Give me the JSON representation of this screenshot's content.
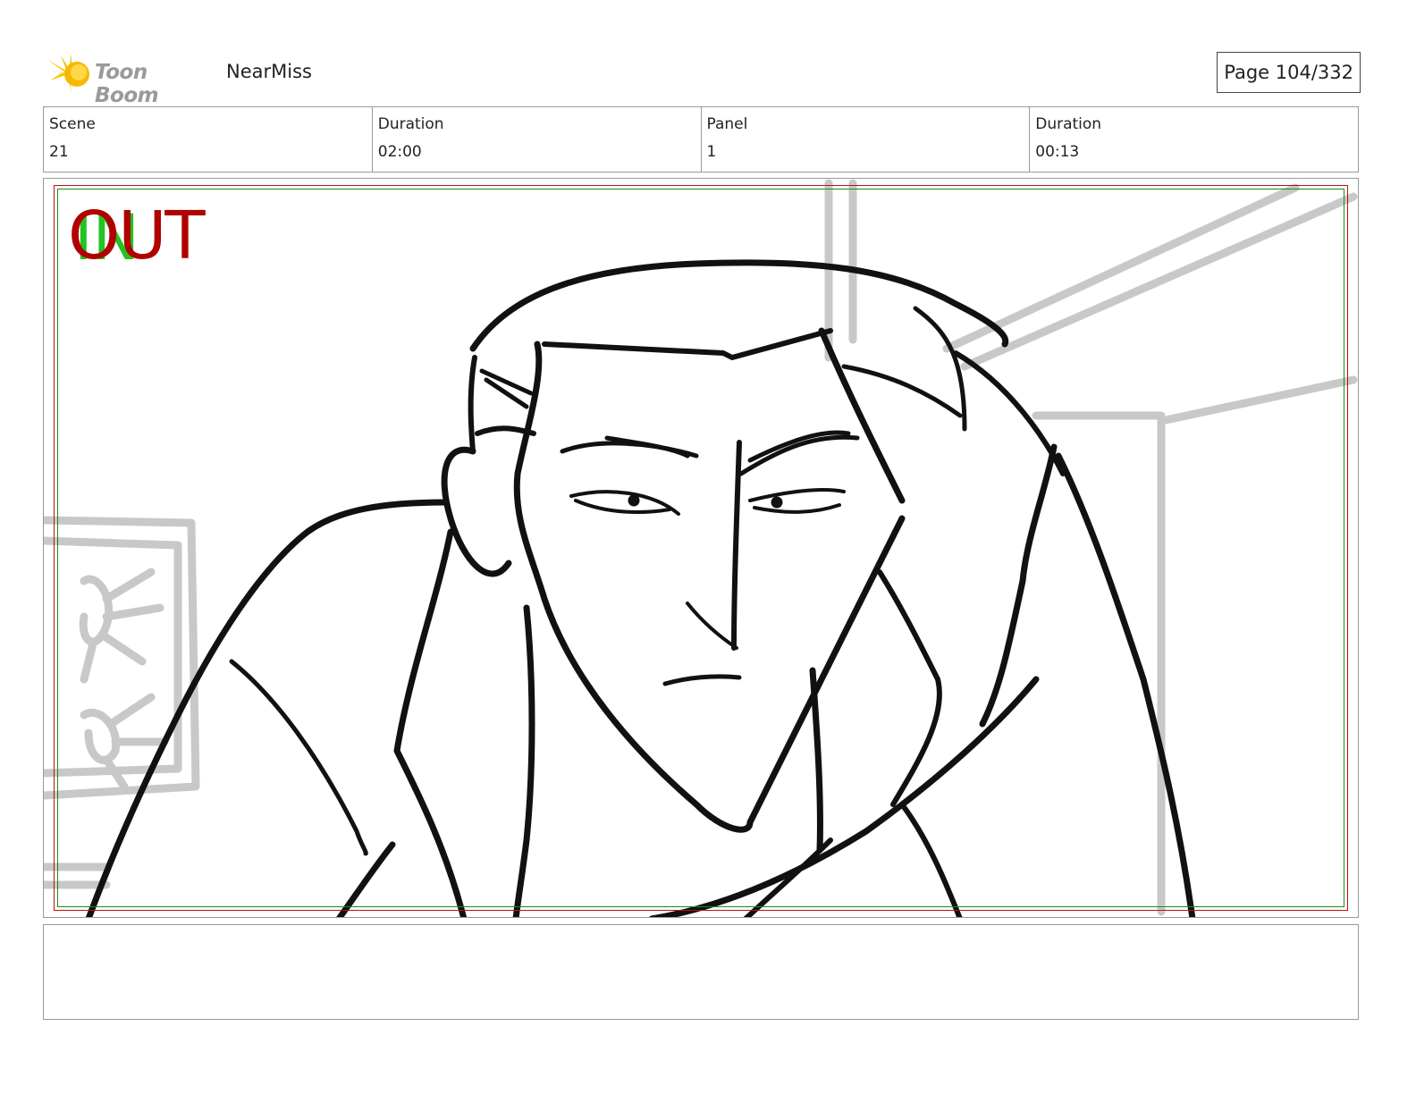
{
  "header": {
    "logo_text": "Toon Boom",
    "project_title": "NearMiss",
    "page_label": "Page 104/332"
  },
  "info": {
    "scene_label": "Scene",
    "scene_value": "21",
    "scene_duration_label": "Duration",
    "scene_duration_value": "02:00",
    "panel_label": "Panel",
    "panel_value": "1",
    "panel_duration_label": "Duration",
    "panel_duration_value": "00:13"
  },
  "panel": {
    "in_mark": "IN",
    "out_mark": "OUT",
    "in_color": "#22c322",
    "out_color": "#b00000"
  },
  "notes": {
    "text": ""
  }
}
